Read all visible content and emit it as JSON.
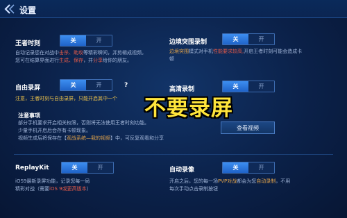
{
  "header": {
    "title": "设置"
  },
  "toggle_labels": {
    "off": "关",
    "on": "开"
  },
  "settings": {
    "highlight": {
      "label": "王者时刻",
      "desc_1a": "自动记录您在对战中",
      "desc_1b": "击杀、助攻",
      "desc_1c": "等精彩瞬间，并剪辑成视频。",
      "desc_2a": "您可在结算界面进行",
      "desc_2b": "生成、保存",
      "desc_2c": "，并",
      "desc_2d": "分享",
      "desc_2e": "给你的朋友。",
      "state": "off"
    },
    "edge_record": {
      "label": "边境突围录制",
      "desc_1a": "边境突围",
      "desc_1b": "模式对手机",
      "desc_1c": "性能要求较高,",
      "desc_1d": "开启王者时刻可能会造成卡",
      "desc_2": "顿",
      "state": "off"
    },
    "free_record": {
      "label": "自由录屏",
      "help": "?",
      "note": "注意，王者时刻与自由录屏，只能开启其中一个",
      "state": "off"
    },
    "hd_record": {
      "label": "高清录制",
      "state": "off"
    },
    "notes": {
      "title": "注意事项",
      "line_1": "部分手机要求开启相关权限，否则将无法使用王者时刻功能。",
      "line_2": "少量手机开启后会存有卡顿现象。",
      "line_3a": "视频生成后将保存在【",
      "line_3b": "观战系统—我的视频",
      "line_3c": "】中，可反复观看和分享",
      "watch_button": "查看视频"
    },
    "replaykit": {
      "label": "ReplayKit",
      "desc_1": "iOS9最新录屏功能，记录您每一局",
      "desc_2a": "精彩对战（需要",
      "desc_2b": "iOS 9或更高版本",
      "desc_2c": "）",
      "state": "off"
    },
    "auto_record": {
      "label": "自动录像",
      "desc_1a": "开启之后，您的每一场",
      "desc_1b": "PVP对战",
      "desc_1c": "都会为您",
      "desc_1d": "自动录制",
      "desc_1e": "，不用",
      "desc_2": "每次手动点击录制按钮",
      "state": "off"
    }
  },
  "overlay": {
    "caption": "不要录屏"
  },
  "colors": {
    "accent": "#2f7ae0",
    "highlight_red": "#e25a4a",
    "highlight_orange": "#e0a24a",
    "overlay_text": "#ffe53b"
  }
}
